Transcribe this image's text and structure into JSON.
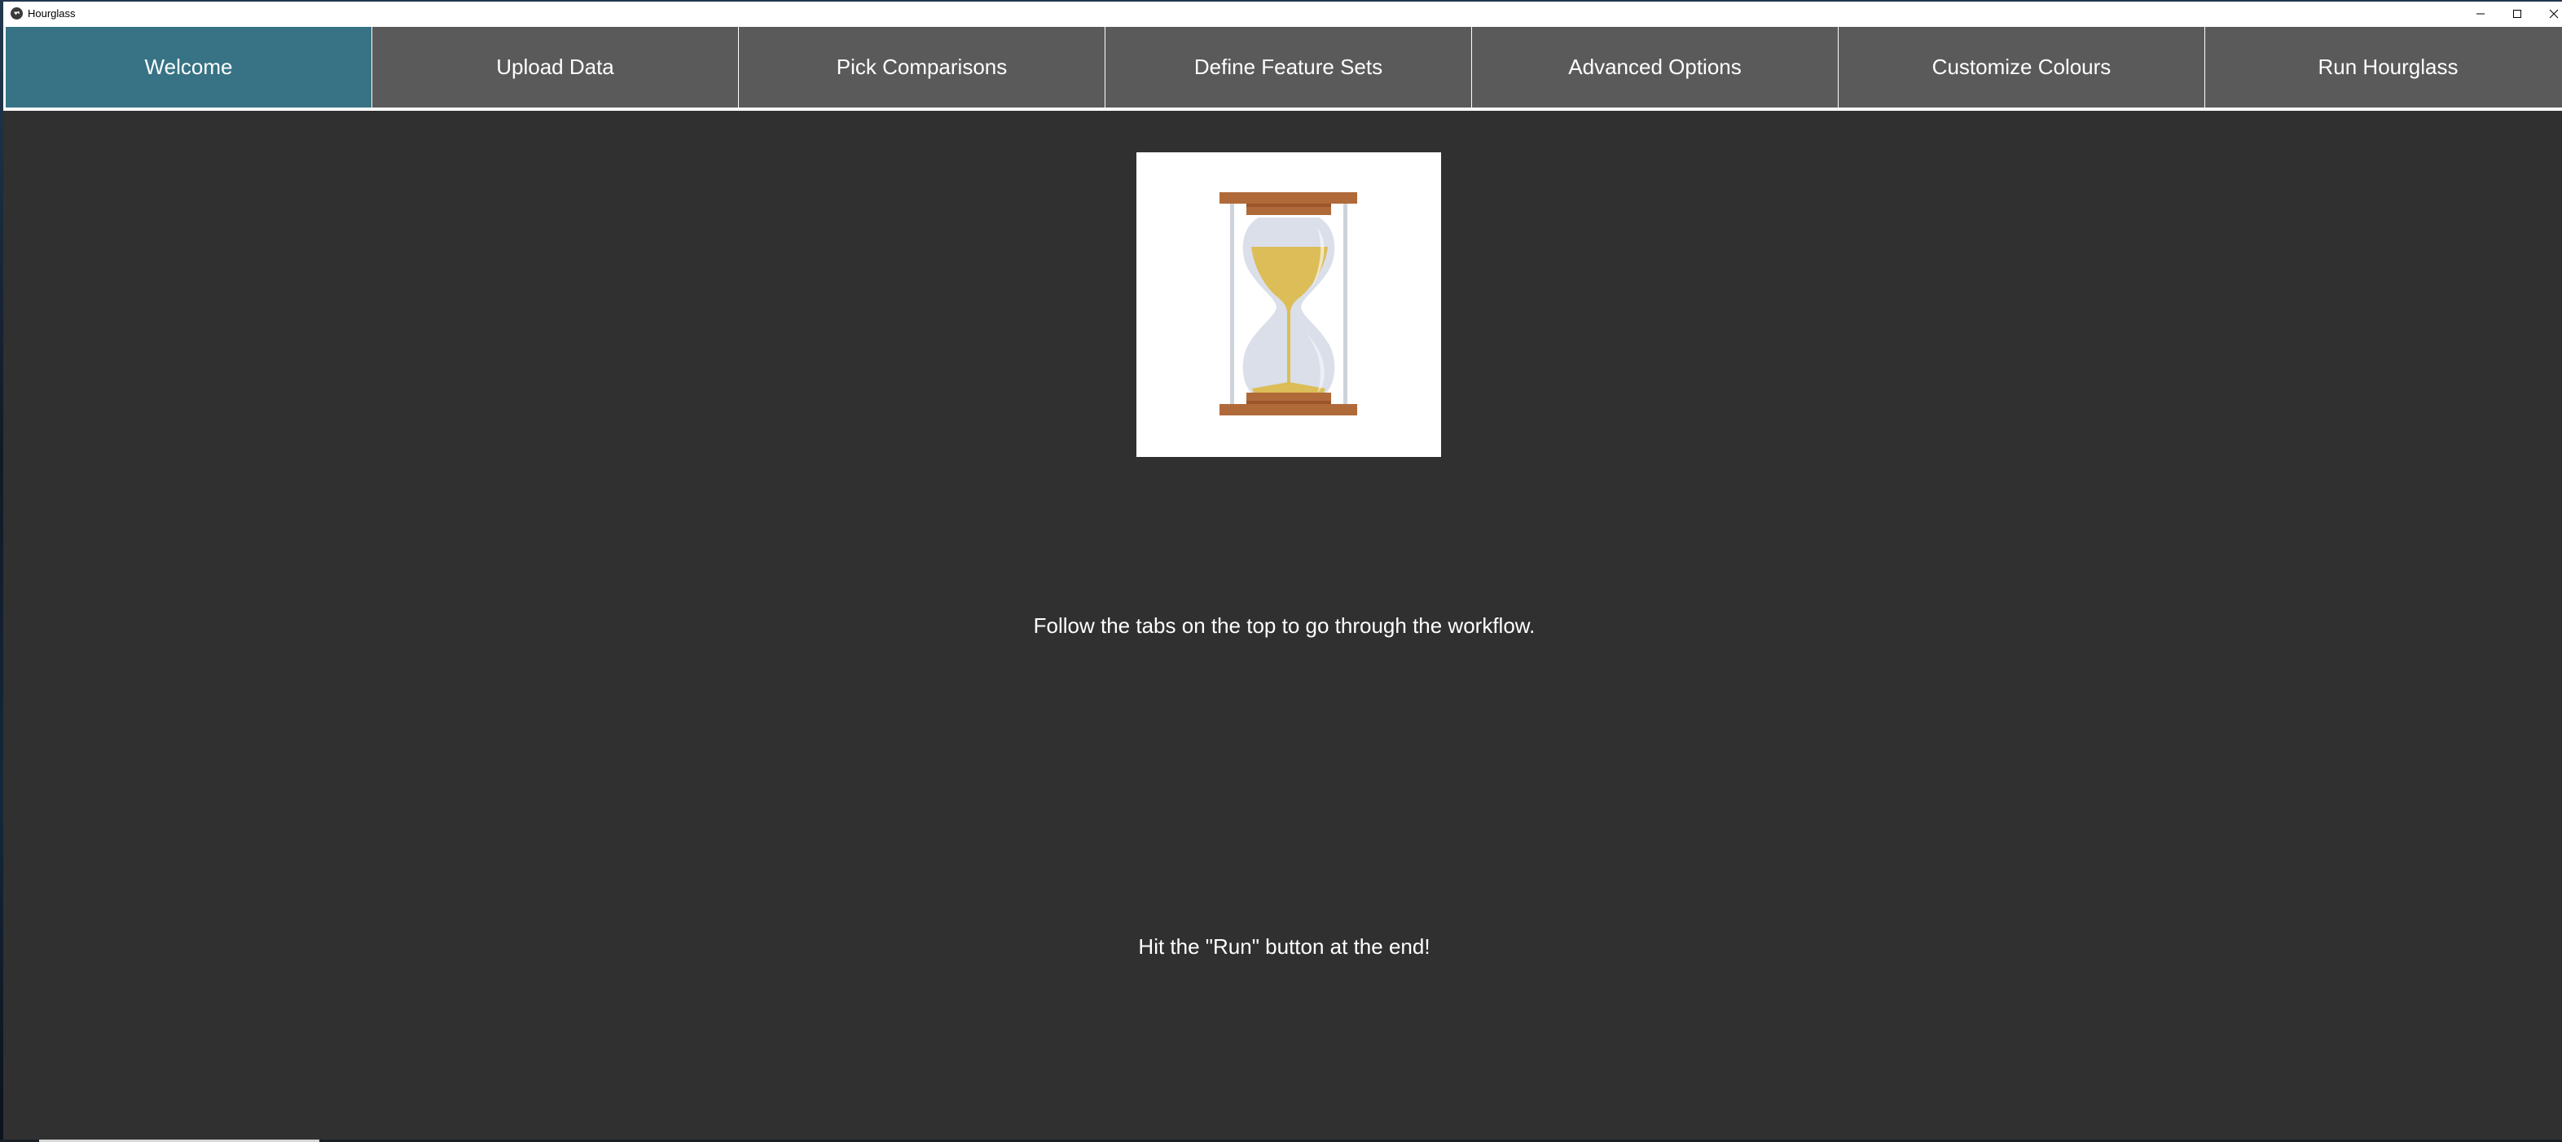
{
  "window": {
    "title": "Hourglass",
    "app_icon": "kivy-logo-icon",
    "controls": {
      "minimize": "minimize-icon",
      "maximize": "maximize-icon",
      "close": "close-icon"
    }
  },
  "tabs": [
    {
      "label": "Welcome",
      "active": true
    },
    {
      "label": "Upload Data",
      "active": false
    },
    {
      "label": "Pick Comparisons",
      "active": false
    },
    {
      "label": "Define Feature Sets",
      "active": false
    },
    {
      "label": "Advanced Options",
      "active": false
    },
    {
      "label": "Customize Colours",
      "active": false
    },
    {
      "label": "Run Hourglass",
      "active": false
    }
  ],
  "welcome": {
    "image": "hourglass-illustration",
    "instruction_1": "Follow the tabs on the top to go through the workflow.",
    "instruction_2": "Hit the \"Run\" button at the end!"
  },
  "colors": {
    "active_tab": "#377385",
    "inactive_tab": "#5a5a5a",
    "content_bg": "#303030",
    "hourglass_wood": "#b06a39",
    "hourglass_wood_dark": "#9b5528",
    "hourglass_sand": "#dcbd57",
    "hourglass_glass": "#dadfea",
    "hourglass_post": "#cdd3da"
  }
}
